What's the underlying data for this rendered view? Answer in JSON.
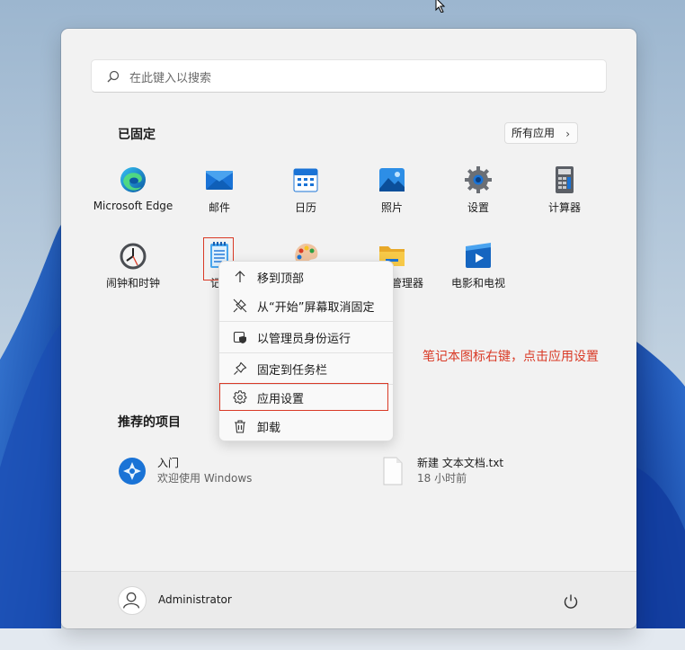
{
  "search": {
    "placeholder": "在此键入以搜索"
  },
  "pinned": {
    "title": "已固定",
    "all_apps_label": "所有应用",
    "apps": [
      {
        "label": "Microsoft Edge",
        "icon": "edge-icon"
      },
      {
        "label": "邮件",
        "icon": "mail-icon"
      },
      {
        "label": "日历",
        "icon": "calendar-icon"
      },
      {
        "label": "照片",
        "icon": "photos-icon"
      },
      {
        "label": "设置",
        "icon": "settings-gear-icon"
      },
      {
        "label": "计算器",
        "icon": "calculator-icon"
      },
      {
        "label": "闹钟和时钟",
        "icon": "clock-icon"
      },
      {
        "label": "记事本",
        "icon": "notepad-icon",
        "visible_label": "记事"
      },
      {
        "label": "画图",
        "icon": "paint-icon"
      },
      {
        "label": "文件资源管理器",
        "icon": "folder-icon",
        "visible_label": "管理器"
      },
      {
        "label": "电影和电视",
        "icon": "movies-tv-icon"
      }
    ]
  },
  "recommended": {
    "title": "推荐的项目",
    "items": [
      {
        "title": "入门",
        "subtitle": "欢迎使用 Windows",
        "icon": "get-started-icon"
      },
      {
        "title": "新建 文本文档.txt",
        "subtitle": "18 小时前",
        "icon": "text-file-icon"
      }
    ]
  },
  "context_menu": {
    "items": [
      {
        "label": "移到顶部",
        "icon": "arrow-up-icon"
      },
      {
        "label": "从“开始”屏幕取消固定",
        "icon": "unpin-icon"
      },
      {
        "label": "以管理员身份运行",
        "icon": "shield-admin-icon"
      },
      {
        "label": "固定到任务栏",
        "icon": "pin-icon"
      },
      {
        "label": "应用设置",
        "icon": "gear-icon"
      },
      {
        "label": "卸载",
        "icon": "trash-icon"
      }
    ]
  },
  "user": {
    "name": "Administrator"
  },
  "annotation": {
    "text": "笔记本图标右键，点击应用设置"
  },
  "colors": {
    "accent": "#0067c0",
    "annotation": "#d93a26",
    "menu_bg": "#f2f2f2"
  }
}
